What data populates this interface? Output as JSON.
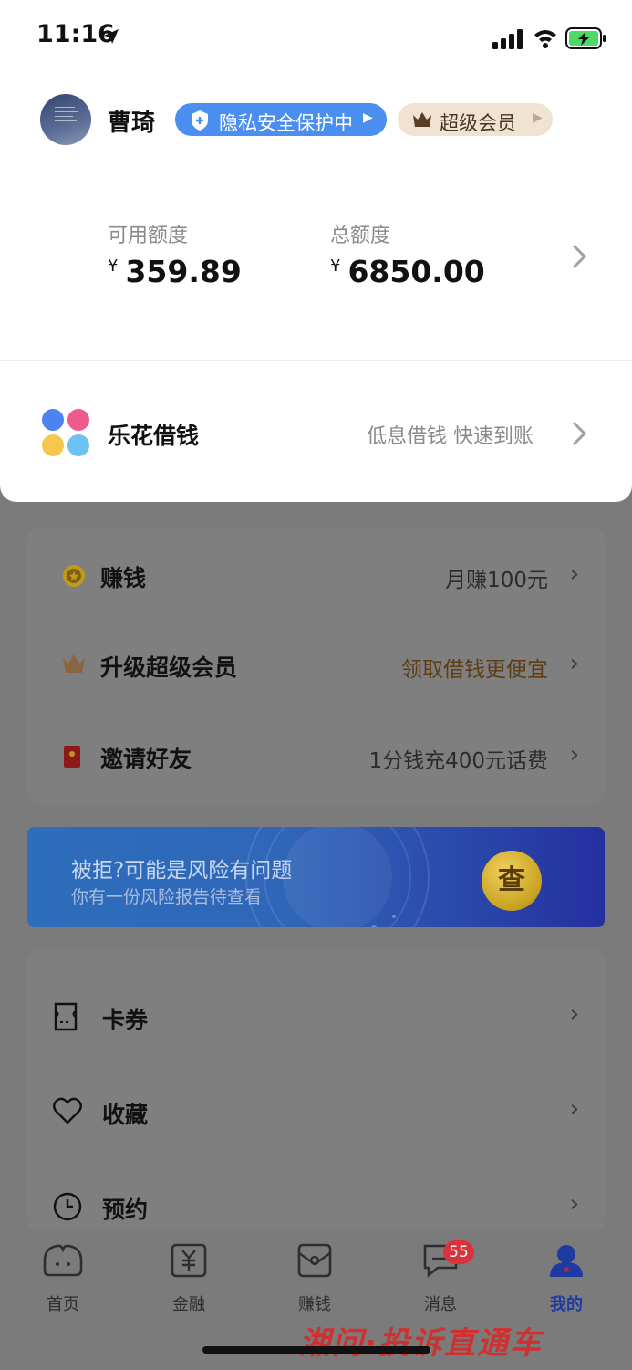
{
  "status_bar": {
    "time": "11:16"
  },
  "header": {
    "user_name": "曹琦",
    "privacy_badge": "隐私安全保护中",
    "vip_badge": "超级会员"
  },
  "credit": {
    "available_label": "可用额度",
    "available_currency": "¥",
    "available_value": "359.89",
    "total_label": "总额度",
    "total_currency": "¥",
    "total_value": "6850.00"
  },
  "lehua": {
    "title": "乐花借钱",
    "subtitle": "低息借钱 快速到账"
  },
  "benefits": [
    {
      "title": "赚钱",
      "right": "月赚100元"
    },
    {
      "title": "升级超级会员",
      "right": "领取借钱更便宜"
    },
    {
      "title": "邀请好友",
      "right": "1分钱充400元话费"
    }
  ],
  "banner": {
    "title": "被拒?可能是风险有问题",
    "subtitle": "你有一份风险报告待查看",
    "button": "查"
  },
  "menu": [
    {
      "title": "卡券"
    },
    {
      "title": "收藏"
    },
    {
      "title": "预约"
    }
  ],
  "tabs": [
    {
      "label": "首页"
    },
    {
      "label": "金融"
    },
    {
      "label": "赚钱"
    },
    {
      "label": "消息",
      "badge": "55"
    },
    {
      "label": "我的"
    }
  ],
  "watermark": "湘问·投诉直通车",
  "colors": {
    "accent_blue": "#4a8ef0",
    "overlay": "#7b7b7b",
    "active_tab": "#1f3aa0",
    "badge_red": "#d8333b",
    "vip_gold": "#b07a36"
  }
}
